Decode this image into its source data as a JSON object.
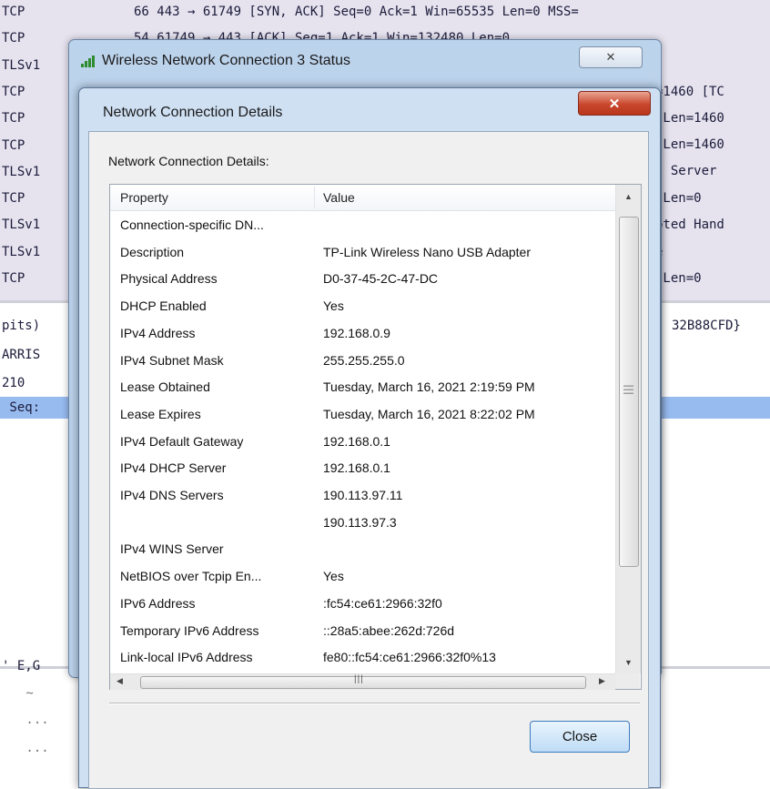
{
  "background": {
    "rows": [
      {
        "proto": "TCP",
        "info": "66 443 → 61749 [SYN, ACK] Seq=0 Ack=1 Win=65535 Len=0 MSS="
      },
      {
        "proto": "TCP",
        "info": "54 61749 → 443 [ACK] Seq=1 Ack=1 Win=132480 Len=0"
      },
      {
        "proto": "TLSv1",
        "info": ""
      },
      {
        "proto": "TCP",
        "info": ""
      },
      {
        "proto": "TCP",
        "info": ""
      },
      {
        "proto": "TCP",
        "info": ""
      },
      {
        "proto": "TLSv1",
        "info": ""
      },
      {
        "proto": "TCP",
        "info": ""
      },
      {
        "proto": "TLSv1",
        "info": ""
      },
      {
        "proto": "TLSv1",
        "info": ""
      },
      {
        "proto": "TCP",
        "info": ""
      }
    ],
    "right_rows": [
      "=1460 [TC",
      " Len=1460",
      " Len=1460",
      ", Server",
      " Len=0",
      "pted Hand",
      "e",
      " Len=0"
    ],
    "detail_left": [
      "pits)",
      "ARRIS",
      "210",
      " Seq:"
    ],
    "detail_right": "32B88CFD}",
    "bytes_left": [
      "' E,G",
      " ~",
      " ...",
      " ..."
    ]
  },
  "status_window": {
    "title": "Wireless Network Connection 3 Status",
    "close_symbol": "✕"
  },
  "details_window": {
    "title": "Network Connection Details",
    "close_symbol": "✕",
    "section_label": "Network Connection Details:",
    "columns": {
      "property": "Property",
      "value": "Value"
    },
    "rows": [
      {
        "property": "Connection-specific DN...",
        "value": ""
      },
      {
        "property": "Description",
        "value": "TP-Link Wireless Nano USB Adapter"
      },
      {
        "property": "Physical Address",
        "value": "D0-37-45-2C-47-DC"
      },
      {
        "property": "DHCP Enabled",
        "value": "Yes"
      },
      {
        "property": "IPv4 Address",
        "value": "192.168.0.9"
      },
      {
        "property": "IPv4 Subnet Mask",
        "value": "255.255.255.0"
      },
      {
        "property": "Lease Obtained",
        "value": "Tuesday, March 16, 2021 2:19:59 PM"
      },
      {
        "property": "Lease Expires",
        "value": "Tuesday, March 16, 2021 8:22:02 PM"
      },
      {
        "property": "IPv4 Default Gateway",
        "value": "192.168.0.1"
      },
      {
        "property": "IPv4 DHCP Server",
        "value": "192.168.0.1"
      },
      {
        "property": "IPv4 DNS Servers",
        "value": "190.113.97.11"
      },
      {
        "property": "",
        "value": "190.113.97.3"
      },
      {
        "property": "IPv4 WINS Server",
        "value": ""
      },
      {
        "property": "NetBIOS over Tcpip En...",
        "value": "Yes"
      },
      {
        "property": "IPv6 Address",
        "value": ":fc54:ce61:2966:32f0"
      },
      {
        "property": "Temporary IPv6 Address",
        "value": "::28a5:abee:262d:726d"
      },
      {
        "property": "Link-local IPv6 Address",
        "value": "fe80::fc54:ce61:2966:32f0%13"
      }
    ],
    "close_button": "Close"
  }
}
